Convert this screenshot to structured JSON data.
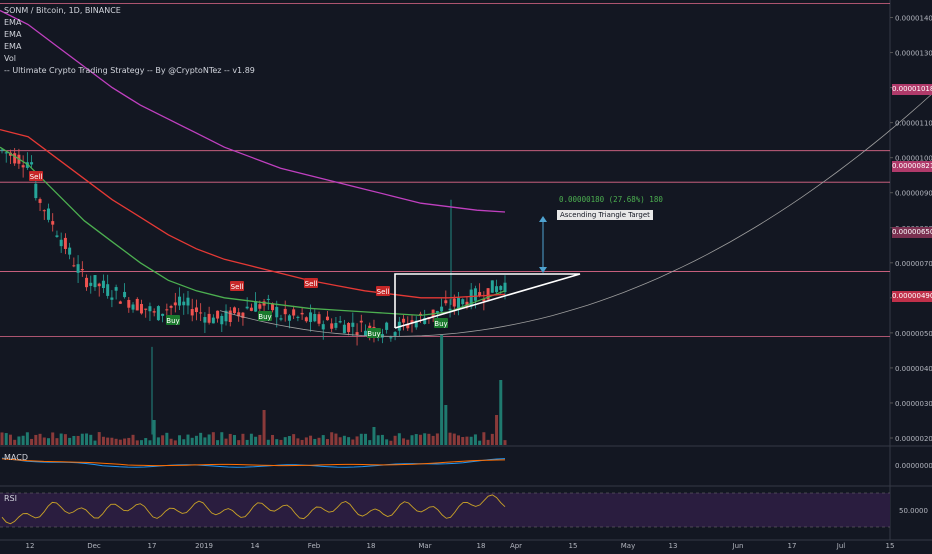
{
  "header": {
    "symbol_line": "SONM / Bitcoin, 1D, BINANCE",
    "ema1": "EMA",
    "ema2": "EMA",
    "ema3": "EMA",
    "vol": "Vol",
    "strategy": "-- Ultimate Crypto Trading Strategy -- By @CryptoNTez -- v1.89"
  },
  "panes": {
    "macd": "MACD",
    "rsi": "RSI"
  },
  "colors": {
    "background": "#131722",
    "up": "#26a69a",
    "down": "#ef5350",
    "ema_short": "#4caf50",
    "ema_mid": "#e53935",
    "ema_long": "#c040c0",
    "hline": "#e06a8a",
    "triangle": "#ffffff",
    "rsi_band": "#2a1d3f"
  },
  "price_axis": {
    "ticks": [
      "0.00001400",
      "0.00001300",
      "0.00001200",
      "0.00001100",
      "0.00001000",
      "0.00000900",
      "0.00000800",
      "0.00000700",
      "0.00000600",
      "0.00000500",
      "0.00000400",
      "0.00000300",
      "0.00000200"
    ],
    "tags": [
      {
        "label": "0.00001018",
        "value": 1.218e-05,
        "color": "#b03a6a"
      },
      {
        "label": "0.00000821",
        "value": 9.76e-06,
        "color": "#b03a6a"
      },
      {
        "label": "0.00000650",
        "value": 8.68e-06,
        "color": "#7a3050"
      },
      {
        "label": "0.00000490",
        "value": 5.87e-06,
        "color": "#c0304a"
      }
    ]
  },
  "macd_axis": {
    "label": "0.00000000"
  },
  "rsi_axis": {
    "label": "50.0000"
  },
  "x_axis": {
    "labels": [
      "12",
      "Dec",
      "17",
      "2019",
      "14",
      "Feb",
      "18",
      "Mar",
      "18",
      "Apr",
      "15",
      "May",
      "13",
      "Jun",
      "17",
      "Jul",
      "15"
    ]
  },
  "annotations": {
    "measure": "0.00000180 (27.68%) 180",
    "target": "Ascending Triangle Target",
    "signals": [
      {
        "type": "Sell",
        "label": "Sell"
      },
      {
        "type": "Sell",
        "label": "Sell"
      },
      {
        "type": "Sell",
        "label": "Sell"
      },
      {
        "type": "Sell",
        "label": "Sell"
      },
      {
        "type": "Buy",
        "label": "Buy"
      },
      {
        "type": "Buy",
        "label": "Buy"
      },
      {
        "type": "Buy",
        "label": "Buy"
      },
      {
        "type": "Buy",
        "label": "Buy"
      }
    ]
  },
  "chart_data": {
    "type": "candlestick",
    "title": "SONM / Bitcoin, 1D, BINANCE",
    "ylim": [
      1.8e-06,
      1.45e-05
    ],
    "horizontal_levels": [
      1.44e-05,
      1.02e-05,
      9.3e-06,
      6.75e-06,
      4.9e-06
    ],
    "series": [
      {
        "name": "EMA",
        "values_note": "short EMA",
        "values": [
          1.03e-05,
          9.8e-06,
          9e-06,
          8.2e-06,
          7.6e-06,
          7e-06,
          6.5e-06,
          6.2e-06,
          6e-06,
          5.9e-06,
          5.8e-06,
          5.7e-06,
          5.65e-06,
          5.6e-06,
          5.55e-06,
          5.5e-06,
          5.6e-06,
          5.9e-06,
          6.2e-06
        ]
      },
      {
        "name": "EMA",
        "values_note": "mid EMA",
        "values": [
          1.08e-05,
          1.06e-05,
          1e-05,
          9.4e-06,
          8.8e-06,
          8.3e-06,
          7.8e-06,
          7.4e-06,
          7.1e-06,
          6.9e-06,
          6.7e-06,
          6.5e-06,
          6.35e-06,
          6.2e-06,
          6.1e-06,
          6e-06,
          6e-06,
          6.05e-06,
          6.1e-06
        ]
      },
      {
        "name": "EMA",
        "values_note": "long EMA",
        "values": [
          1.42e-05,
          1.38e-05,
          1.32e-05,
          1.26e-05,
          1.2e-05,
          1.15e-05,
          1.11e-05,
          1.07e-05,
          1.03e-05,
          1e-05,
          9.7e-06,
          9.5e-06,
          9.3e-06,
          9.1e-06,
          8.9e-06,
          8.7e-06,
          8.6e-06,
          8.5e-06,
          8.45e-06
        ]
      }
    ]
  }
}
